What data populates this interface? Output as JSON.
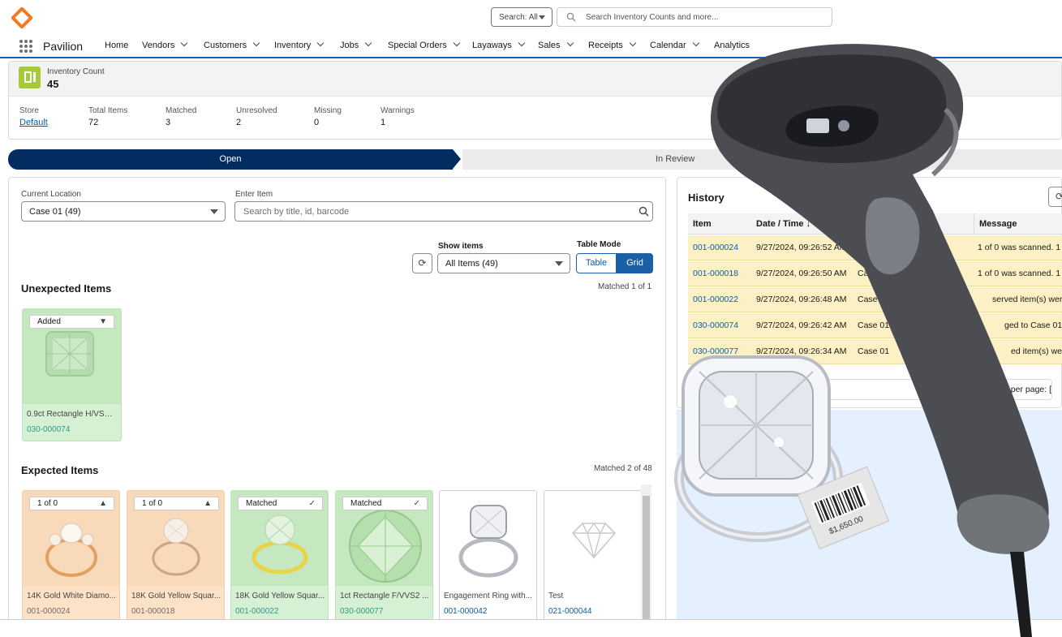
{
  "global": {
    "search_scope": "Search: All",
    "search_placeholder": "Search Inventory Counts and more..."
  },
  "nav": {
    "app_name": "Pavilion",
    "items": [
      "Home",
      "Vendors",
      "Customers",
      "Inventory",
      "Jobs",
      "Special Orders",
      "Layaways",
      "Sales",
      "Receipts",
      "Calendar",
      "Analytics"
    ]
  },
  "record": {
    "type_label": "Inventory Count",
    "number": "45",
    "fields": [
      {
        "label": "Store",
        "value": "Default"
      },
      {
        "label": "Total Items",
        "value": "72"
      },
      {
        "label": "Matched",
        "value": "3"
      },
      {
        "label": "Unresolved",
        "value": "2"
      },
      {
        "label": "Missing",
        "value": "0"
      },
      {
        "label": "Warnings",
        "value": "1"
      }
    ]
  },
  "path": {
    "current": "Open",
    "next": "In Review"
  },
  "controls": {
    "location_label": "Current Location",
    "location_value": "Case 01 (49)",
    "enter_item_label": "Enter Item",
    "enter_item_placeholder": "Search by title, id, barcode",
    "show_items_label": "Show items",
    "show_items_value": "All Items (49)",
    "table_mode_label": "Table Mode",
    "mode_table": "Table",
    "mode_grid": "Grid"
  },
  "unexpected": {
    "title": "Unexpected Items",
    "matched": "Matched 1 of 1",
    "items": [
      {
        "badge": "Added",
        "name": "0.9ct Rectangle H/VS1 ...",
        "id": "030-000074",
        "color": "green"
      }
    ]
  },
  "expected": {
    "title": "Expected Items",
    "matched": "Matched 2 of 48",
    "items": [
      {
        "badge": "1 of 0",
        "icon": "warning",
        "name": "14K Gold White Diamo...",
        "id": "001-000024",
        "color": "orange"
      },
      {
        "badge": "1 of 0",
        "icon": "warning",
        "name": "18K Gold Yellow Squar...",
        "id": "001-000018",
        "color": "orange"
      },
      {
        "badge": "Matched",
        "icon": "check",
        "name": "18K Gold Yellow Squar...",
        "id": "001-000022",
        "color": "green"
      },
      {
        "badge": "Matched",
        "icon": "check",
        "name": "1ct Rectangle F/VVS2 ...",
        "id": "030-000077",
        "color": "green"
      },
      {
        "badge": "",
        "icon": "",
        "name": "Engagement Ring with...",
        "id": "001-000042",
        "color": "white"
      },
      {
        "badge": "",
        "icon": "",
        "name": "Test",
        "id": "021-000044",
        "color": "white"
      }
    ]
  },
  "history": {
    "title": "History",
    "columns": [
      "Item",
      "Date / Time ↓",
      "",
      "Message"
    ],
    "rows": [
      {
        "item": "001-000024",
        "datetime": "9/27/2024, 09:26:52 AM",
        "location": "",
        "message": "1 of 0 was scanned. 1 it"
      },
      {
        "item": "001-000018",
        "datetime": "9/27/2024, 09:26:50 AM",
        "location": "Cas",
        "message": "1 of 0 was scanned. 1 it"
      },
      {
        "item": "001-000022",
        "datetime": "9/27/2024, 09:26:48 AM",
        "location": "Case",
        "message": "served item(s) were"
      },
      {
        "item": "030-000074",
        "datetime": "9/27/2024, 09:26:42 AM",
        "location": "Case 01",
        "message": "ged to Case 01. Ex"
      },
      {
        "item": "030-000077",
        "datetime": "9/27/2024, 09:26:34 AM",
        "location": "Case 01",
        "message": "ed item(s) were"
      }
    ],
    "pager_text": "per page: ["
  },
  "overlay": {
    "tag_price": "$1,650.00"
  }
}
